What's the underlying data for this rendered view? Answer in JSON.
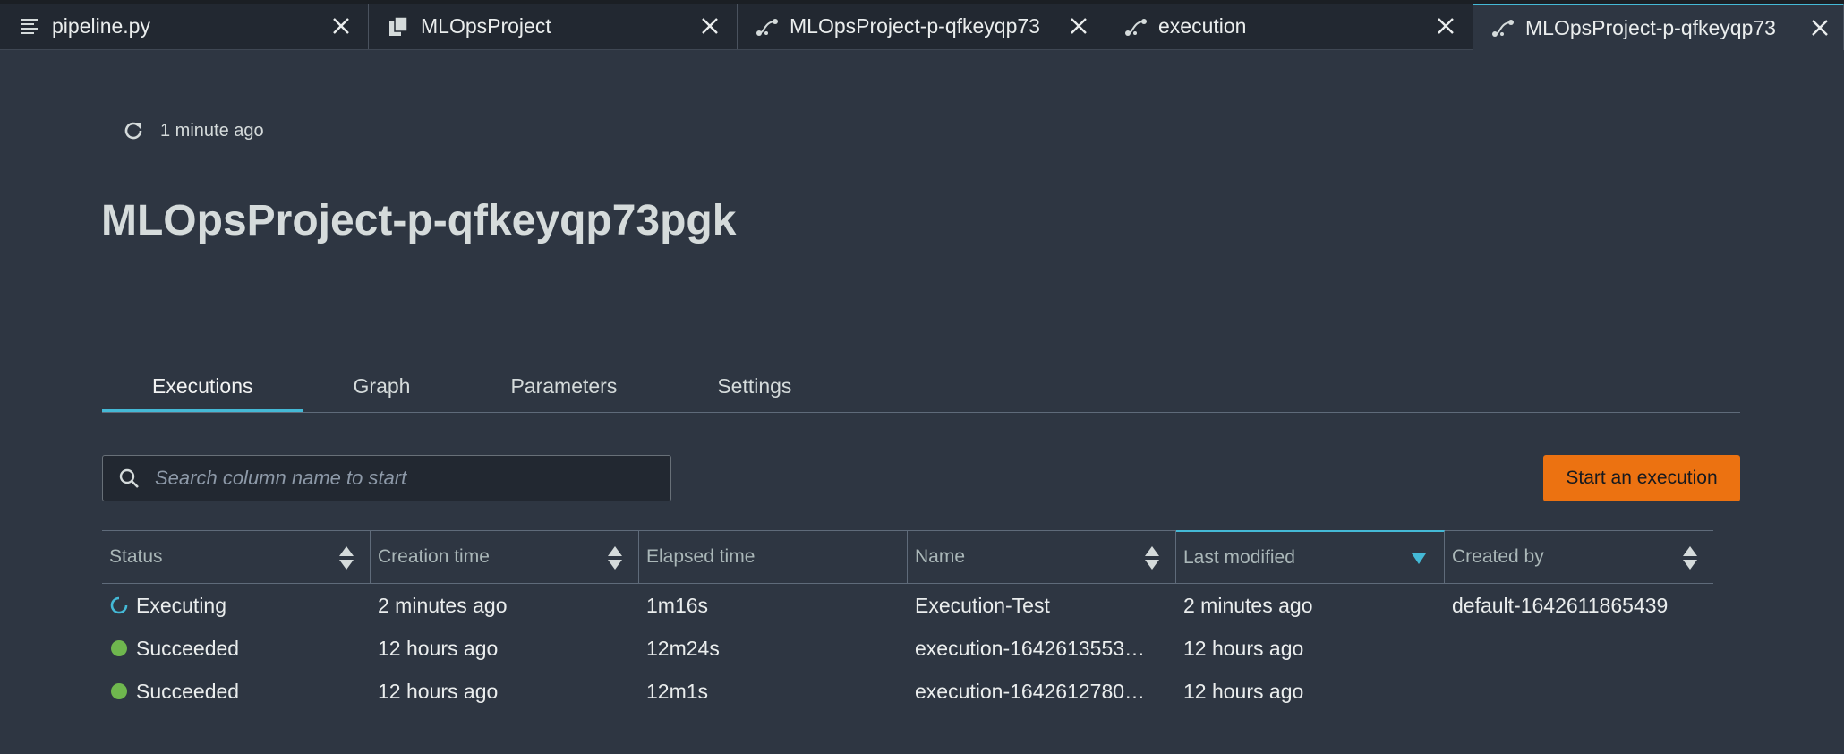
{
  "colors": {
    "accent": "#44b9d6",
    "primary_button": "#ec7211",
    "success": "#6fb74e",
    "background": "#2e3642"
  },
  "tabs": [
    {
      "icon": "file-lines-icon",
      "label": "pipeline.py"
    },
    {
      "icon": "project-icon",
      "label": "MLOpsProject"
    },
    {
      "icon": "pipeline-icon",
      "label": "MLOpsProject-p-qfkeyqp73"
    },
    {
      "icon": "pipeline-icon",
      "label": "execution"
    },
    {
      "icon": "pipeline-icon",
      "label": "MLOpsProject-p-qfkeyqp73",
      "active": true
    }
  ],
  "refresh": {
    "icon": "refresh-icon",
    "text": "1 minute ago"
  },
  "page_title": "MLOpsProject-p-qfkeyqp73pgk",
  "page_tabs": [
    {
      "label": "Executions",
      "active": true
    },
    {
      "label": "Graph"
    },
    {
      "label": "Parameters"
    },
    {
      "label": "Settings"
    }
  ],
  "search": {
    "placeholder": "Search column name to start",
    "value": ""
  },
  "start_button": "Start an execution",
  "table": {
    "columns": [
      "Status",
      "Creation time",
      "Elapsed time",
      "Name",
      "Last modified",
      "Created by"
    ],
    "sorted_column": "Last modified",
    "sort_direction": "descending",
    "rows": [
      {
        "status": "Executing",
        "status_icon": "spinner-icon",
        "creation_time": "2 minutes ago",
        "elapsed": "1m16s",
        "name": "Execution-Test",
        "last_modified": "2 minutes ago",
        "created_by": "default-1642611865439"
      },
      {
        "status": "Succeeded",
        "status_icon": "success-dot-icon",
        "creation_time": "12 hours ago",
        "elapsed": "12m24s",
        "name": "execution-1642613553…",
        "last_modified": "12 hours ago",
        "created_by": ""
      },
      {
        "status": "Succeeded",
        "status_icon": "success-dot-icon",
        "creation_time": "12 hours ago",
        "elapsed": "12m1s",
        "name": "execution-1642612780…",
        "last_modified": "12 hours ago",
        "created_by": ""
      }
    ]
  }
}
